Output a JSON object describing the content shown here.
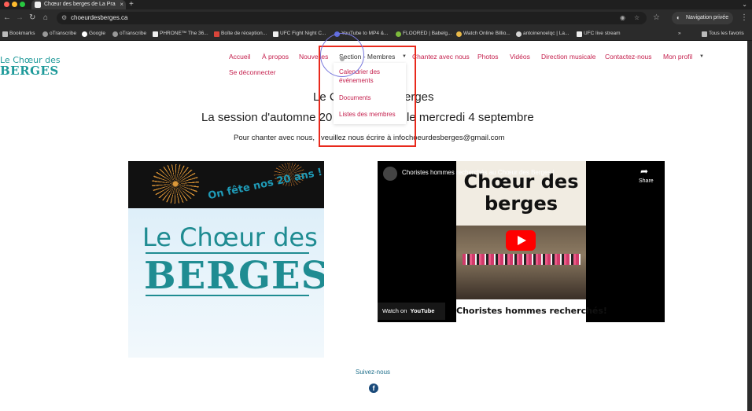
{
  "browser": {
    "tab_title": "Chœur des berges de La Pra",
    "address": "choeurdesberges.ca",
    "private_label": "Navigation privée",
    "bookmarks": [
      "Bookmarks",
      "oTranscribe",
      "Google",
      "oTranscribe",
      "PHRONE™ The 36...",
      "Boîte de réception...",
      "UFC Fight Night C...",
      "YouTube to MP4 &...",
      "FLOORED | Babelg...",
      "Watch Online Billio...",
      "antoinenoelqc | La...",
      "UFC live stream"
    ],
    "all_bookmarks": "Tous les favoris"
  },
  "logo": {
    "top": "Le Chœur des",
    "bottom": "BERGES"
  },
  "nav": {
    "items": [
      "Accueil",
      "À propos",
      "Nouvelles",
      "Section - Membres",
      "Chantez avec nous",
      "Photos",
      "Vidéos",
      "Direction musicale",
      "Contactez-nous",
      "Mon profil"
    ],
    "logout": "Se déconnecter"
  },
  "dropdown": [
    "Calendrier des événements",
    "Documents",
    "Listes des membres"
  ],
  "content": {
    "heading_left": "Le C",
    "heading_right": "erges",
    "session_left": "La session d'automne 20",
    "session_right": "le mercredi 4 septembre",
    "contact_left": "Pour chanter avec nous,",
    "contact_right": "veuillez nous écrire à infochoeurdesberges@gmail.com"
  },
  "art": {
    "anniversary": "On fête nos 20 ans !",
    "logo_top": "Le Chœur des",
    "logo_bottom": "BERGES"
  },
  "video": {
    "title": "Choristes hommes recherchés au Chœur des Berges !",
    "share": "Share",
    "thumb_title": "Chœur des berges",
    "banner": "Choristes hommes recherchés!",
    "watch_on": "Watch on",
    "youtube": "YouTube"
  },
  "footer": {
    "follow": "Suivez-nous"
  },
  "colors": {
    "menu": "#c5214e",
    "brand": "#1f9a9a",
    "highlight": "#e8291c"
  }
}
